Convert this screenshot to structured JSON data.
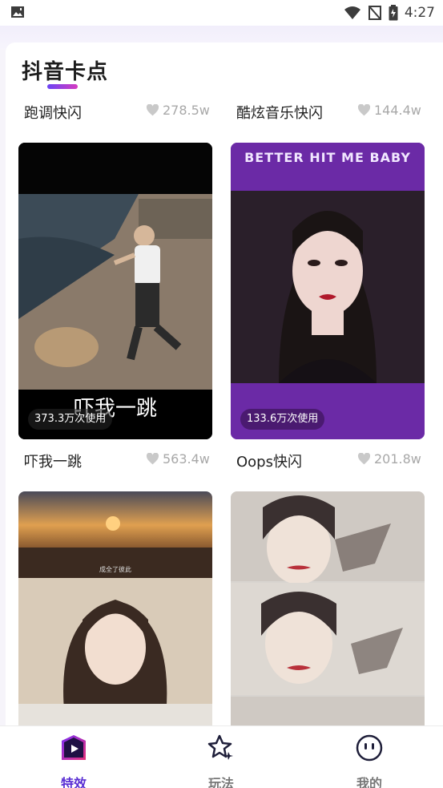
{
  "status": {
    "time": "4:27"
  },
  "section": {
    "title": "抖音卡点"
  },
  "top_row": [
    {
      "name": "跑调快闪",
      "likes": "278.5w"
    },
    {
      "name": "酷炫音乐快闪",
      "likes": "144.4w"
    }
  ],
  "cards": [
    {
      "name": "吓我一跳",
      "likes": "563.4w",
      "usage": "373.3万次使用",
      "caption": "吓我一跳"
    },
    {
      "name": "Oops快闪",
      "likes": "201.8w",
      "usage": "133.6万次使用",
      "caption": "BETTER HIT ME BABY"
    },
    {
      "name": "",
      "likes": "",
      "caption": "成全了彼此"
    },
    {
      "name": "",
      "likes": ""
    }
  ],
  "nav": [
    {
      "label": "特效",
      "icon": "play-icon",
      "active": true
    },
    {
      "label": "玩法",
      "icon": "sparkle-star-icon",
      "active": false
    },
    {
      "label": "我的",
      "icon": "smiley-icon",
      "active": false
    }
  ],
  "colors": {
    "accent": "#5a2fd3",
    "purple_card": "#6b2aa6"
  }
}
